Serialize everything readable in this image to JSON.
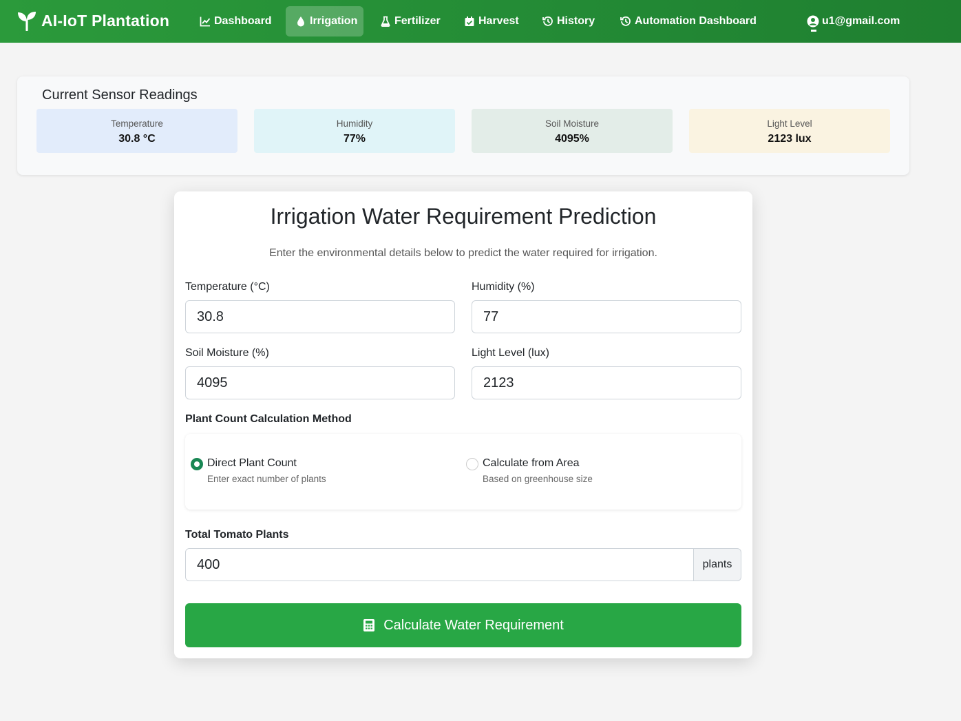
{
  "colors": {
    "nav_green": "#28963a",
    "button_green": "#28a745",
    "radio_checked": "#198754"
  },
  "brand": {
    "name": "AI-IoT Plantation",
    "icon": "seedling-icon"
  },
  "nav": {
    "items": [
      {
        "label": "Dashboard",
        "icon": "chart-line-icon",
        "active": false
      },
      {
        "label": "Irrigation",
        "icon": "water-drop-icon",
        "active": true
      },
      {
        "label": "Fertilizer",
        "icon": "flask-icon",
        "active": false
      },
      {
        "label": "Harvest",
        "icon": "calendar-check-icon",
        "active": false
      },
      {
        "label": "History",
        "icon": "history-icon",
        "active": false
      },
      {
        "label": "Automation Dashboard",
        "icon": "history-icon",
        "active": false
      }
    ],
    "user_email": "u1@gmail.com"
  },
  "sensors": {
    "title": "Current Sensor Readings",
    "tiles": [
      {
        "label": "Temperature",
        "value": "30.8 °C",
        "bg": "#e2ecfb"
      },
      {
        "label": "Humidity",
        "value": "77%",
        "bg": "#e0f4f8"
      },
      {
        "label": "Soil Moisture",
        "value": "4095%",
        "bg": "#e3ede8"
      },
      {
        "label": "Light Level",
        "value": "2123 lux",
        "bg": "#faf3e1"
      }
    ]
  },
  "form": {
    "title": "Irrigation Water Requirement Prediction",
    "subtitle": "Enter the environmental details below to predict the water required for irrigation.",
    "fields": {
      "temperature": {
        "label": "Temperature (°C)",
        "value": "30.8"
      },
      "humidity": {
        "label": "Humidity (%)",
        "value": "77"
      },
      "soil_moisture": {
        "label": "Soil Moisture (%)",
        "value": "4095"
      },
      "light_level": {
        "label": "Light Level (lux)",
        "value": "2123"
      }
    },
    "method": {
      "label": "Plant Count Calculation Method",
      "options": [
        {
          "title": "Direct Plant Count",
          "desc": "Enter exact number of plants",
          "checked": true
        },
        {
          "title": "Calculate from Area",
          "desc": "Based on greenhouse size",
          "checked": false
        }
      ]
    },
    "plants": {
      "label": "Total Tomato Plants",
      "value": "400",
      "unit": "plants"
    },
    "submit_label": "Calculate Water Requirement"
  }
}
